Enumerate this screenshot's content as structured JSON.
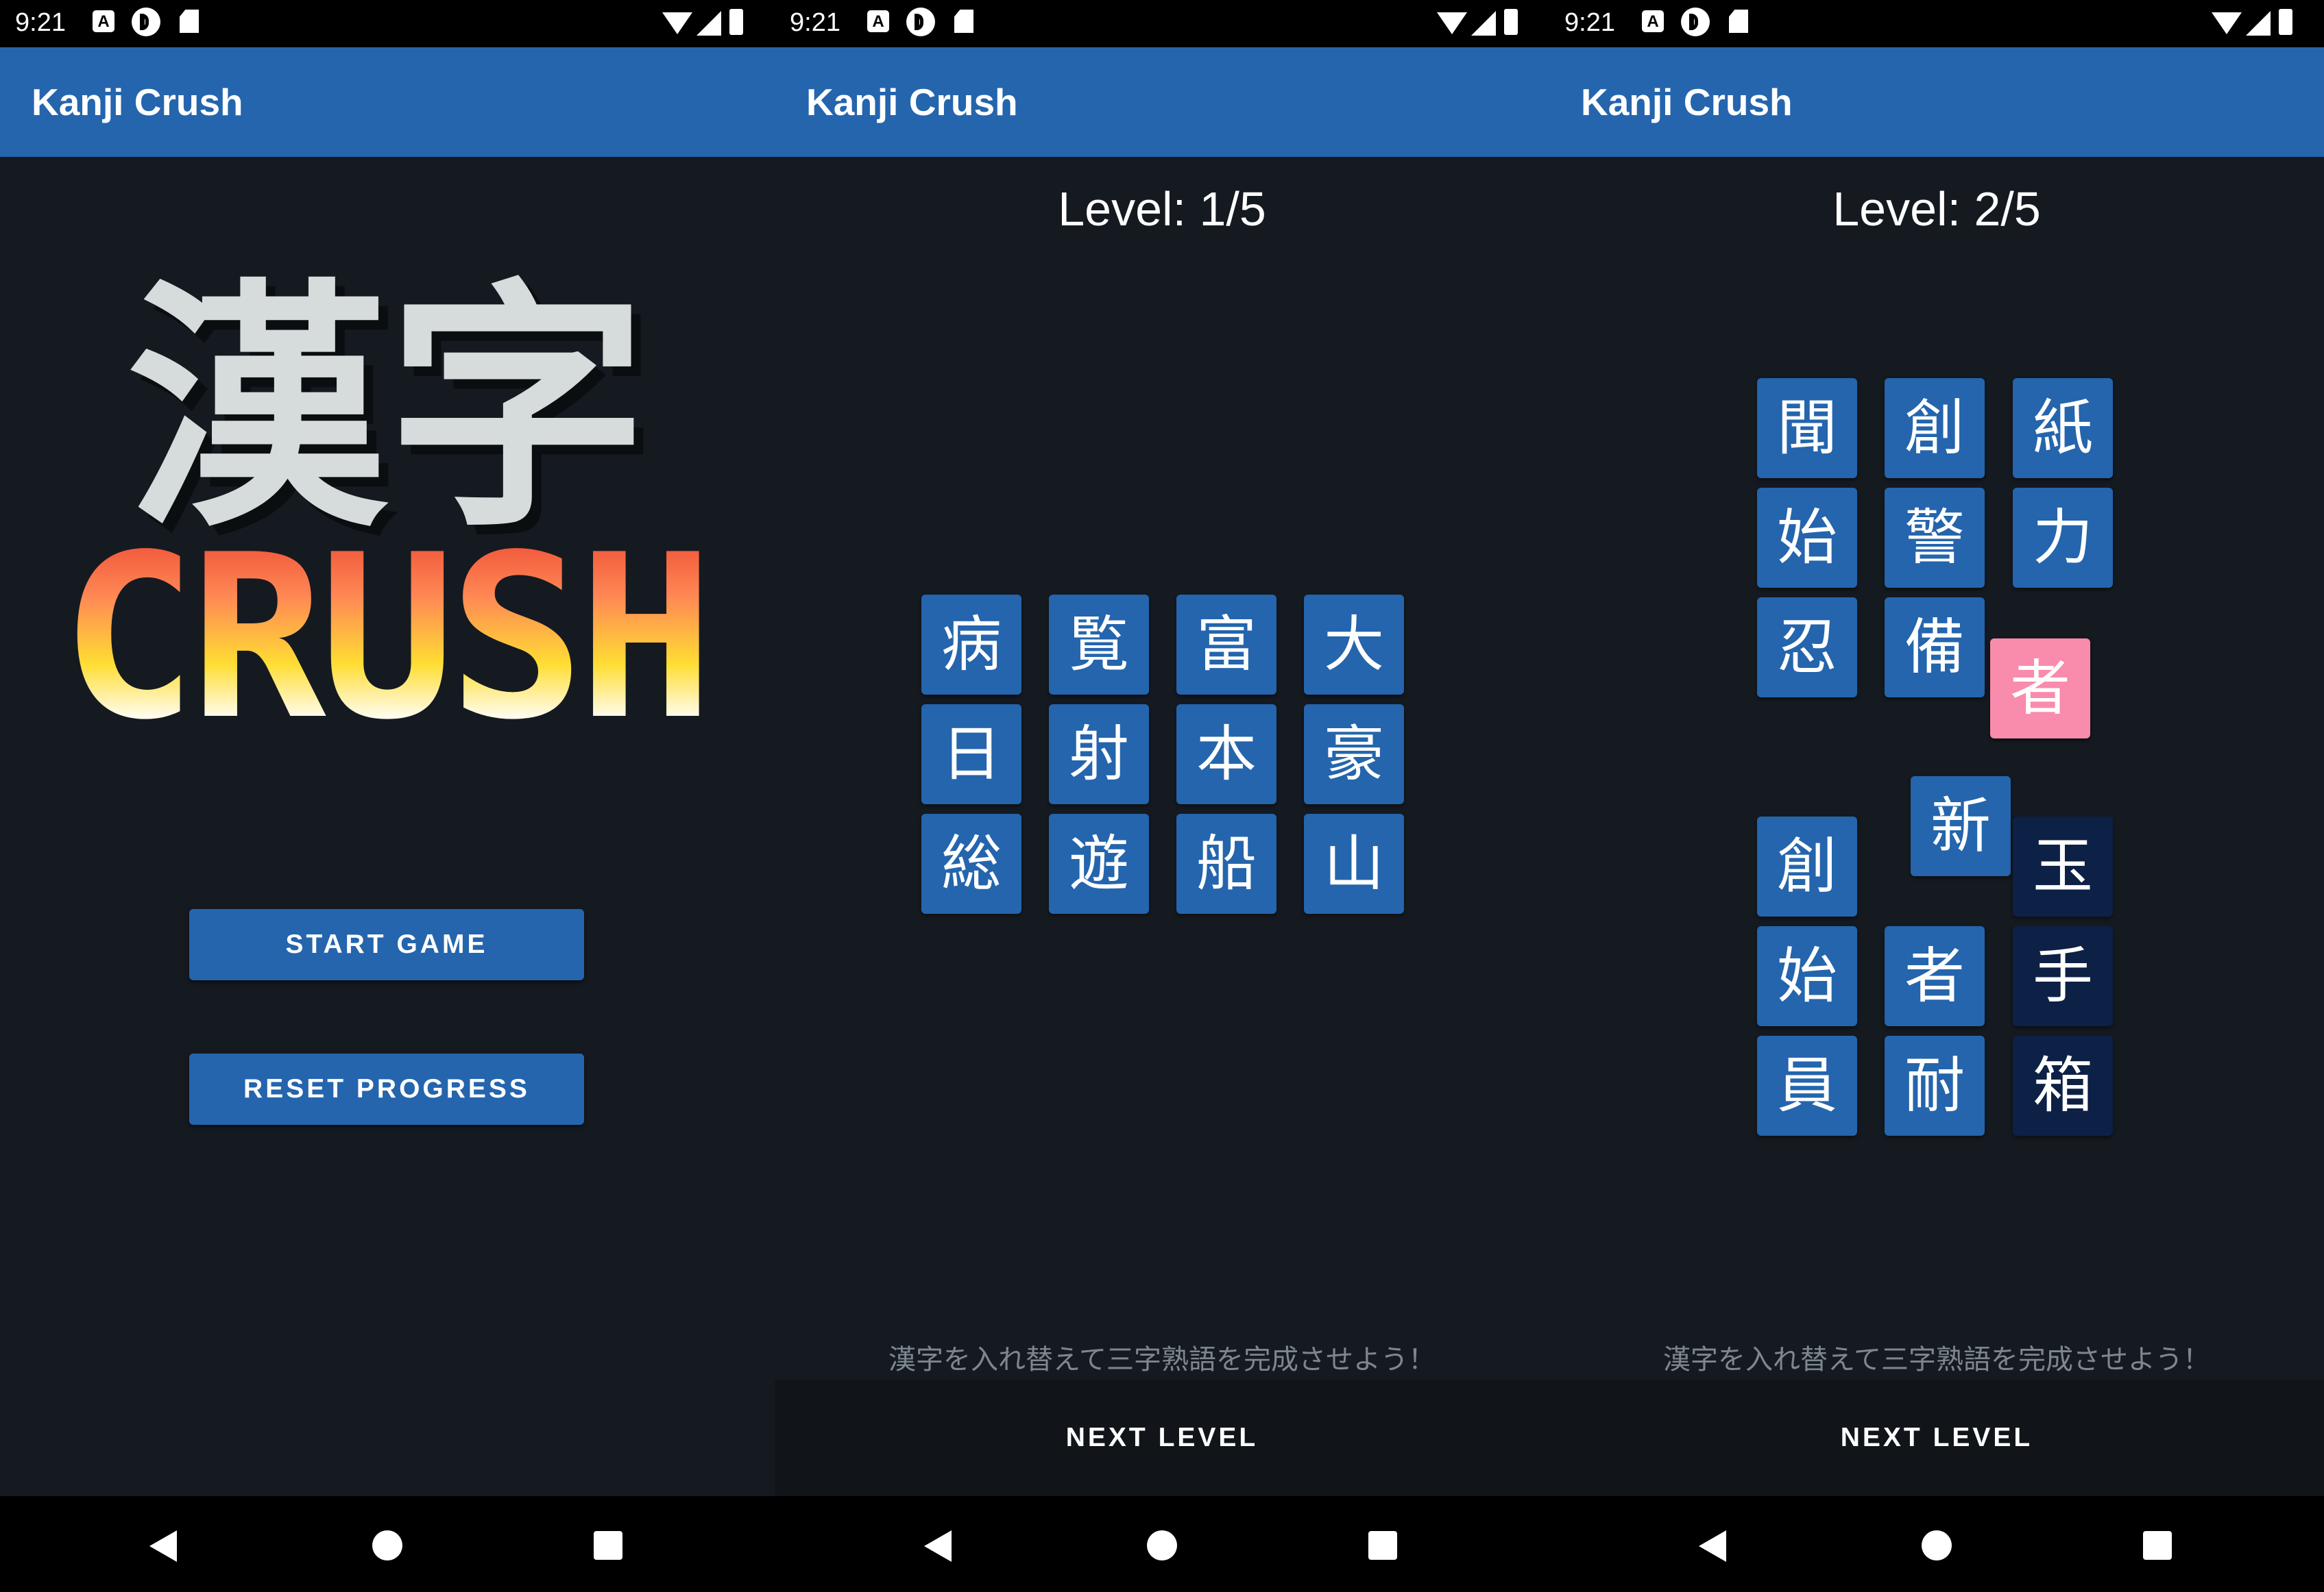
{
  "status_bar": {
    "time": "9:21",
    "icon_a": "A"
  },
  "app": {
    "title": "Kanji Crush"
  },
  "home": {
    "logo_kanji": "漢字",
    "logo_text": "CRUSH",
    "start_button": "START GAME",
    "reset_button": "RESET PROGRESS"
  },
  "level1": {
    "label": "Level: 1/5",
    "tiles": [
      "病",
      "覧",
      "富",
      "大",
      "日",
      "射",
      "本",
      "豪",
      "総",
      "遊",
      "船",
      "山"
    ],
    "hint": "漢字を入れ替えて三字熟語を完成させよう！",
    "next_button": "NEXT LEVEL"
  },
  "level2": {
    "label": "Level: 2/5",
    "tiles": [
      "聞",
      "創",
      "紙",
      "始",
      "警",
      "力",
      "忍",
      "備",
      "者",
      "新",
      "創",
      "玉",
      "始",
      "者",
      "手",
      "員",
      "耐",
      "箱"
    ],
    "hint": "漢字を入れ替えて三字熟語を完成させよう！",
    "next_button": "NEXT LEVEL"
  },
  "colors": {
    "app_bar": "#2465ad",
    "background": "#151a21",
    "tile": "#2465ad",
    "tile_dark": "#0d2146",
    "tile_selected": "#f98bac"
  },
  "icons": {
    "nav_back": "back-triangle-icon",
    "nav_home": "home-circle-icon",
    "nav_recents": "recents-square-icon",
    "status": [
      "a-icon",
      "p-icon",
      "sd-card-icon",
      "wifi-icon",
      "signal-icon",
      "battery-icon"
    ]
  }
}
